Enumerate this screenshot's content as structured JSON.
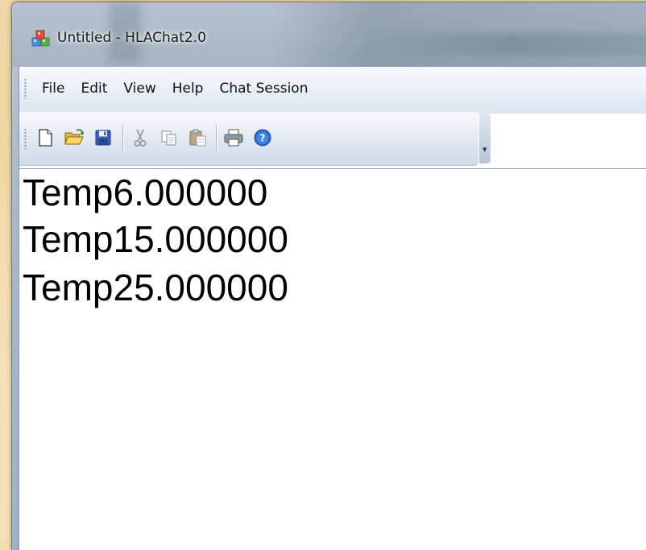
{
  "window": {
    "title": "Untitled - HLAChat2.0",
    "app_icon": "hlachat-app-icon"
  },
  "menu": {
    "items": [
      {
        "label": "File"
      },
      {
        "label": "Edit"
      },
      {
        "label": "View"
      },
      {
        "label": "Help"
      },
      {
        "label": "Chat Session"
      }
    ]
  },
  "toolbar": {
    "buttons": [
      {
        "icon": "new-document-icon"
      },
      {
        "icon": "open-folder-icon"
      },
      {
        "icon": "save-floppy-icon"
      },
      {
        "icon": "cut-scissors-icon"
      },
      {
        "icon": "copy-icon"
      },
      {
        "icon": "paste-icon"
      },
      {
        "icon": "print-icon"
      },
      {
        "icon": "help-icon"
      }
    ],
    "overflow_icon": "toolbar-overflow-icon"
  },
  "document": {
    "lines": [
      "Temp6.000000",
      "Temp15.000000",
      "Temp25.000000"
    ]
  },
  "colors": {
    "desktop": "#f2dbac",
    "window_frame": "#a8b8cb",
    "text": "#000000"
  }
}
